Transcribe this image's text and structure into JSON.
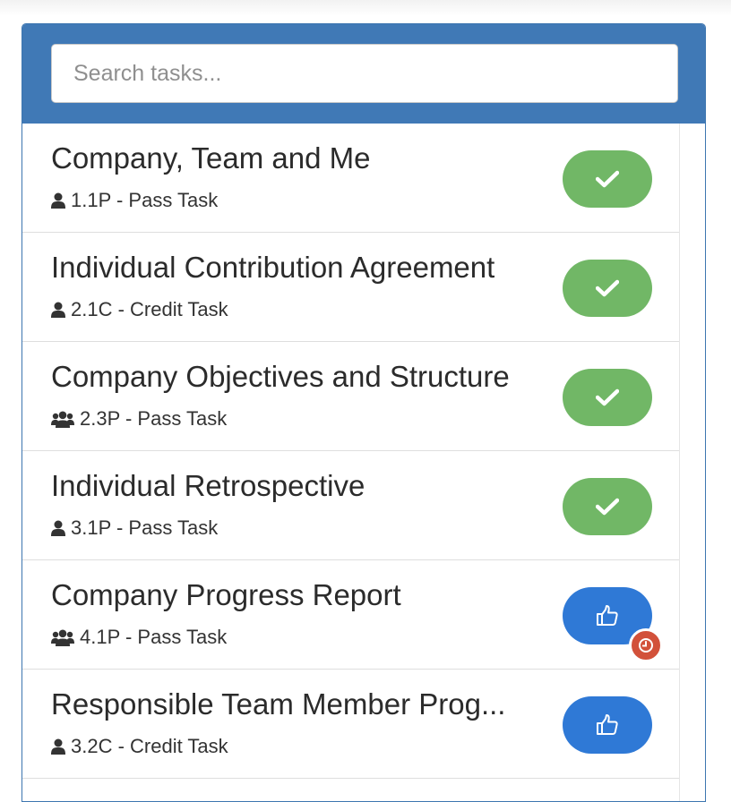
{
  "search": {
    "placeholder": "Search tasks..."
  },
  "tasks": [
    {
      "name": "Company, Team and Me",
      "code": "1.1P - Pass Task",
      "owner_icon": "user-icon",
      "status": "complete",
      "status_icon": "check-icon",
      "overdue": false
    },
    {
      "name": "Individual Contribution Agreement",
      "code": "2.1C - Credit Task",
      "owner_icon": "user-icon",
      "status": "complete",
      "status_icon": "check-icon",
      "overdue": false
    },
    {
      "name": "Company Objectives and Structure",
      "code": "2.3P - Pass Task",
      "owner_icon": "users-icon",
      "status": "complete",
      "status_icon": "check-icon",
      "overdue": false
    },
    {
      "name": "Individual Retrospective",
      "code": "3.1P - Pass Task",
      "owner_icon": "user-icon",
      "status": "complete",
      "status_icon": "check-icon",
      "overdue": false
    },
    {
      "name": "Company Progress Report",
      "code": "4.1P - Pass Task",
      "owner_icon": "users-icon",
      "status": "discuss",
      "status_icon": "thumbs-up-icon",
      "overdue": true
    },
    {
      "name": "Responsible Team Member Prog...",
      "code": "3.2C - Credit Task",
      "owner_icon": "user-icon",
      "status": "discuss",
      "status_icon": "thumbs-up-icon",
      "overdue": false
    }
  ],
  "colors": {
    "header": "#4079b6",
    "complete": "#71b766",
    "discuss": "#2f79d6",
    "overdue": "#d2513a"
  }
}
